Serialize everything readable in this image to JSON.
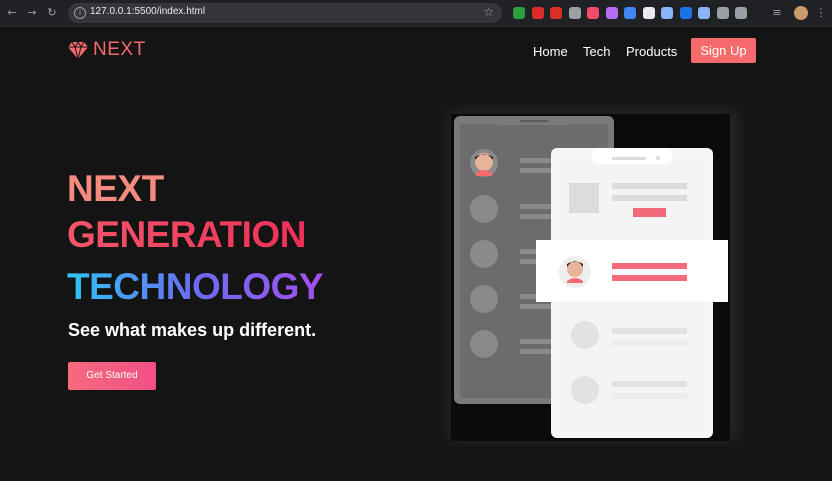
{
  "browser": {
    "url": "127.0.0.1:5500/index.html",
    "extension_colors": [
      "#2d9d3e",
      "#e02b2b",
      "#d93025",
      "#9aa0a6",
      "#f24a6a",
      "#b66cf2",
      "#4285f4",
      "#e8eaed",
      "#8ab4f8",
      "#1a73e8",
      "#8ab4f8",
      "#9aa0a6",
      "#9aa0a6"
    ]
  },
  "brand": {
    "name": "NEXT",
    "color": "#f56b6b"
  },
  "nav": {
    "items": [
      "Home",
      "Tech",
      "Products"
    ],
    "signup_label": "Sign Up"
  },
  "hero": {
    "line1": "NEXT",
    "line2": "GENERATION",
    "line3": "TECHNOLOGY",
    "tagline": "See what makes up different.",
    "cta_label": "Get Started"
  },
  "colors": {
    "background": "#141414",
    "accent": "#f56b6b",
    "gradient_blue": "#2ec5f5",
    "gradient_purple": "#a44ff0"
  }
}
